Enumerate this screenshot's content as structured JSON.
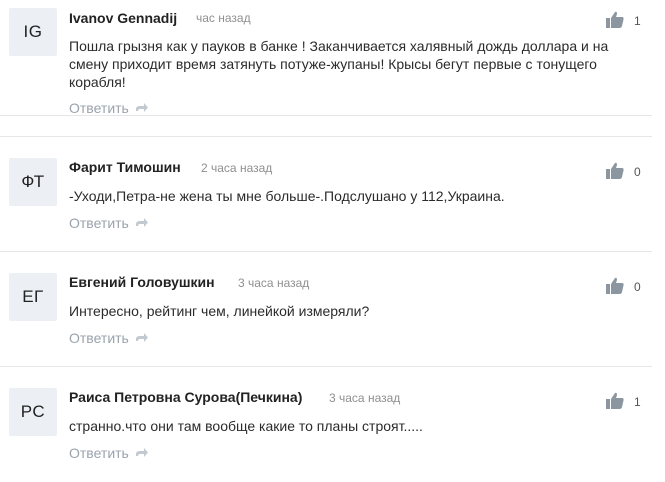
{
  "comments": [
    {
      "initials": "IG",
      "author": "Ivanov Gennadij",
      "time": "час назад",
      "text": "Пошла грызня как у пауков в банке ! Заканчивается халявный дождь доллара и на смену приходит время затянуть потуже-жупаны! Крысы бегут первые с тонущего корабля!",
      "reply_label": "Ответить",
      "likes": "1"
    },
    {
      "initials": "ФТ",
      "author": "Фарит Тимошин",
      "time": "2 часа назад",
      "text": "-Уходи,Петра-не жена ты мне больше-.Подслушано у 112,Украина.",
      "reply_label": "Ответить",
      "likes": "0"
    },
    {
      "initials": "ЕГ",
      "author": "Евгений Головушкин",
      "time": "3 часа назад",
      "text": "Интересно, рейтинг чем, линейкой измеряли?",
      "reply_label": "Ответить",
      "likes": "0"
    },
    {
      "initials": "РС",
      "author": "Раиса Петровна Сурова(Печкина)",
      "time": "3 часа назад",
      "text": "странно.что они там вообще какие то планы строят.....",
      "reply_label": "Ответить",
      "likes": "1"
    }
  ],
  "icons": {
    "like": "thumbs-up-icon",
    "reply": "reply-arrow-icon"
  },
  "colors": {
    "avatar_bg": "#eceff3",
    "muted": "#8f8f8f",
    "reply": "#9aa3ad",
    "icon": "#8c96a0"
  }
}
